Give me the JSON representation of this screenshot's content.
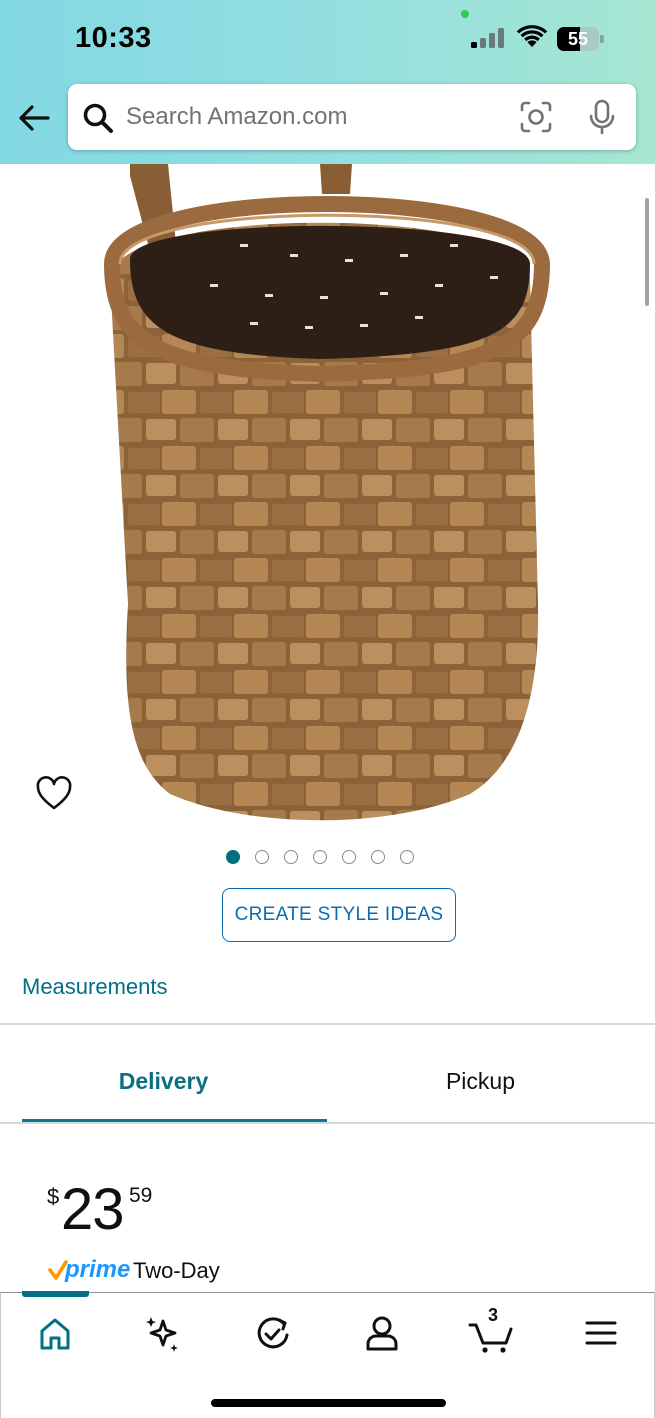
{
  "status_bar": {
    "time": "10:33",
    "battery_level": "55",
    "battery_fraction": 0.55,
    "icons": [
      "signal-icon",
      "wifi-icon",
      "battery-icon"
    ]
  },
  "header": {
    "back_icon": "arrow-left-icon",
    "search": {
      "placeholder": "Search Amazon.com",
      "value": "",
      "icons": [
        "search-icon",
        "camera-scan-icon",
        "microphone-icon"
      ]
    },
    "gradient_colors": [
      "#82d8e3",
      "#a6e6d2"
    ]
  },
  "product": {
    "image_alt": "woven wooden hanging basket",
    "wishlist_icon": "heart-outline-icon",
    "image_count": 7,
    "active_image_index": 0,
    "style_button_label": "CREATE STYLE IDEAS",
    "measurements_link": "Measurements"
  },
  "tabs": {
    "items": [
      {
        "label": "Delivery",
        "active": true
      },
      {
        "label": "Pickup",
        "active": false
      }
    ]
  },
  "price": {
    "symbol": "$",
    "whole": "23",
    "fraction": "59"
  },
  "shipping": {
    "badge": "prime",
    "text": "Two-Day"
  },
  "bottom_nav": {
    "items": [
      {
        "icon": "home-icon",
        "active": true
      },
      {
        "icon": "sparkle-icon",
        "active": false
      },
      {
        "icon": "orders-check-icon",
        "active": false
      },
      {
        "icon": "account-icon",
        "active": false
      },
      {
        "icon": "cart-icon",
        "active": false
      },
      {
        "icon": "menu-icon",
        "active": false
      }
    ],
    "cart_count": "3"
  },
  "colors": {
    "link_teal": "#007185",
    "tab_active": "#0b6f80",
    "button_blue": "#0b6cb0",
    "prime_blue": "#1a98ff",
    "prime_check": "#ff9900"
  }
}
